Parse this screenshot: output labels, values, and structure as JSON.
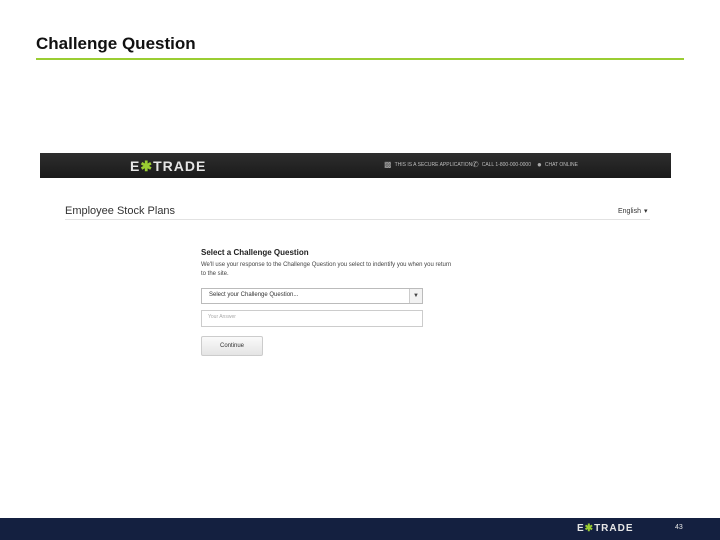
{
  "slide": {
    "title": "Challenge Question",
    "page_number": "43"
  },
  "brand": {
    "logo_left": "E",
    "logo_star": "✱",
    "logo_right": "TRADE",
    "accent": "#9acd32",
    "footer_bg": "#142040"
  },
  "topbar": {
    "secure_label": "THIS IS A SECURE APPLICATION",
    "call_label": "CALL 1-800-000-0000",
    "chat_label": "CHAT ONLINE",
    "lock_icon": "lock-icon",
    "phone_icon": "phone-icon",
    "chat_icon": "chat-bubble-icon"
  },
  "page": {
    "header": "Employee Stock Plans",
    "language": "English",
    "language_caret": "▾"
  },
  "form": {
    "title": "Select a Challenge Question",
    "description": "We'll use your response to the Challenge Question you select to indentify you when you return to the site.",
    "select_value": "Select your Challenge Question...",
    "select_arrow": "▼",
    "answer_placeholder": "Your Answer",
    "continue_label": "Continue"
  }
}
